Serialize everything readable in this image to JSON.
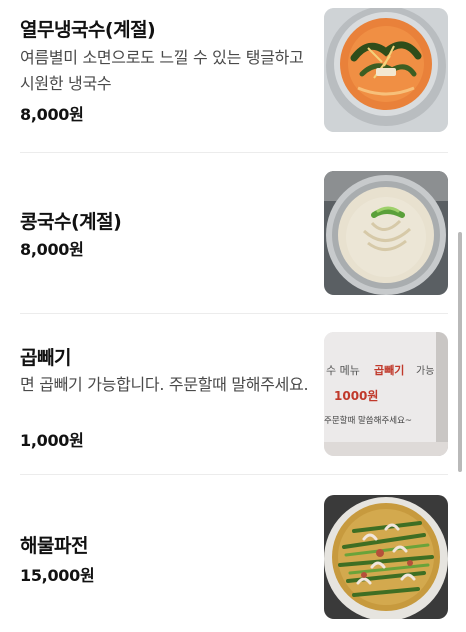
{
  "menu": {
    "items": [
      {
        "name": "열무냉국수(계절)",
        "description": "여름별미 소면으로도 느낄 수 있는 탱글하고 시원한 냉국수",
        "price": "8,000원",
        "image": "yeolmu-naengguksu-photo"
      },
      {
        "name": "콩국수(계절)",
        "description": "",
        "price": "8,000원",
        "image": "kongguksu-photo"
      },
      {
        "name": "곱빼기",
        "description": "면 곱빼기 가능합니다. 주문할때 말해주세요.",
        "price": "1,000원",
        "image": "gopbaegi-sign-photo",
        "image_text": {
          "line1_a": "수 메뉴",
          "line1_b": "곱빼기",
          "line1_c": "가능",
          "line2": "1000원",
          "line3": "주문할때 말씀해주세요~"
        }
      },
      {
        "name": "해물파전",
        "description": "",
        "price": "15,000원",
        "image": "haemul-pajeon-photo"
      }
    ]
  },
  "colors": {
    "text": "#111111",
    "description": "#4a4a4a",
    "divider": "#ececec",
    "sign_red": "#c0392b"
  }
}
